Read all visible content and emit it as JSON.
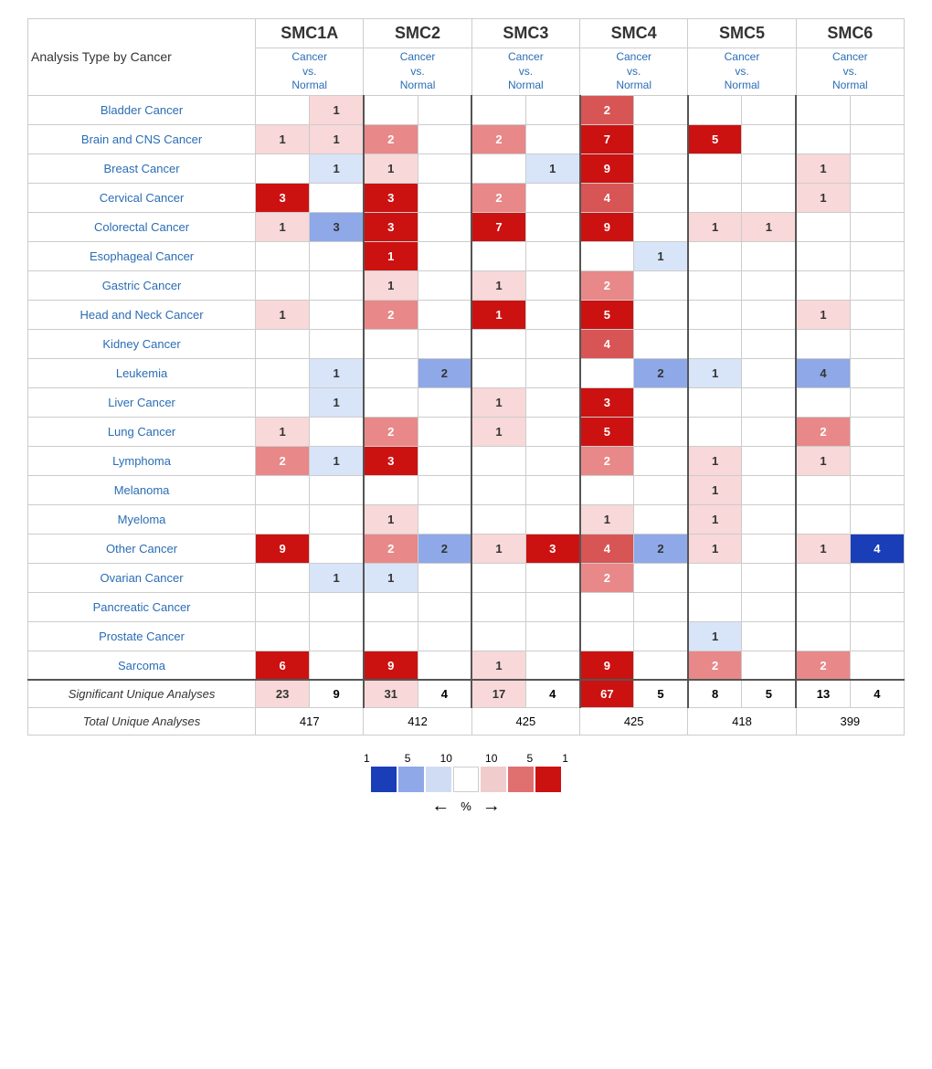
{
  "title": "Analysis Type by Cancer",
  "columns": [
    "SMC1A",
    "SMC2",
    "SMC3",
    "SMC4",
    "SMC5",
    "SMC6"
  ],
  "subHeader": "Cancer\nvs.\nNormal",
  "cancers": [
    "Bladder Cancer",
    "Brain and CNS Cancer",
    "Breast Cancer",
    "Cervical Cancer",
    "Colorectal Cancer",
    "Esophageal Cancer",
    "Gastric Cancer",
    "Head and Neck Cancer",
    "Kidney Cancer",
    "Leukemia",
    "Liver Cancer",
    "Lung Cancer",
    "Lymphoma",
    "Melanoma",
    "Myeloma",
    "Other Cancer",
    "Ovarian Cancer",
    "Pancreatic Cancer",
    "Prostate Cancer",
    "Sarcoma"
  ],
  "cells": {
    "Bladder Cancer": [
      [
        "",
        ""
      ],
      [
        "1",
        "c-r1"
      ],
      [
        "",
        ""
      ],
      [
        "2",
        "c-r4"
      ],
      [
        "",
        ""
      ],
      [
        "",
        ""
      ]
    ],
    "Brain and CNS Cancer": [
      [
        "1",
        "c-r1"
      ],
      [
        "1",
        "c-r1"
      ],
      [
        "2",
        "c-r3"
      ],
      [
        "2",
        "c-r3"
      ],
      [
        "7",
        "c-r5"
      ],
      [
        ""
      ],
      [
        "5",
        "c-r5"
      ],
      [
        ""
      ],
      [
        "",
        ""
      ],
      [
        "",
        ""
      ]
    ],
    "Breast Cancer": [
      [
        "",
        ""
      ],
      [
        "1",
        "c-b1"
      ],
      [
        "1",
        "c-r1"
      ],
      [
        "",
        ""
      ],
      [
        "1",
        "c-b1"
      ],
      [
        ""
      ],
      [
        "9",
        "c-r5"
      ],
      [
        ""
      ],
      [
        "",
        ""
      ],
      [
        "1",
        "c-r1"
      ]
    ],
    "Cervical Cancer": [
      [
        "3",
        "c-r5"
      ],
      [
        ""
      ],
      [
        "3",
        "c-r5"
      ],
      [
        ""
      ],
      [
        "2",
        "c-r3"
      ],
      [
        ""
      ],
      [
        "4",
        "c-r4"
      ],
      [
        ""
      ],
      [
        "",
        ""
      ],
      [
        "1",
        "c-r1"
      ]
    ],
    "Colorectal Cancer": [
      [
        "1",
        "c-r1"
      ],
      [
        "3",
        "c-b3"
      ],
      [
        "3",
        "c-r5"
      ],
      [
        ""
      ],
      [
        "7",
        "c-r5"
      ],
      [
        ""
      ],
      [
        "9",
        "c-r5"
      ],
      [
        ""
      ],
      [
        "1",
        "c-r1"
      ],
      [
        "1",
        "c-r1"
      ]
    ],
    "Esophageal Cancer": [
      [
        "",
        ""
      ],
      [
        "",
        ""
      ],
      [
        "1",
        "c-r5"
      ],
      [
        ""
      ],
      [
        "",
        ""
      ],
      [
        ""
      ],
      [
        "",
        ""
      ],
      [
        "1",
        "c-b1"
      ],
      [
        "",
        ""
      ],
      [
        "",
        ""
      ]
    ],
    "Gastric Cancer": [
      [
        "",
        ""
      ],
      [
        "",
        ""
      ],
      [
        "1",
        "c-r1"
      ],
      [
        ""
      ],
      [
        "1",
        "c-r1"
      ],
      [
        ""
      ],
      [
        "2",
        "c-r3"
      ],
      [
        ""
      ],
      [
        "",
        ""
      ],
      [
        "",
        ""
      ]
    ],
    "Head and Neck Cancer": [
      [
        "1",
        "c-r1"
      ],
      [
        ""
      ],
      [
        "2",
        "c-r3"
      ],
      [
        ""
      ],
      [
        "1",
        "c-r5"
      ],
      [
        ""
      ],
      [
        "5",
        "c-r5"
      ],
      [
        ""
      ],
      [
        "",
        ""
      ],
      [
        "1",
        "c-r1"
      ]
    ],
    "Kidney Cancer": [
      [
        "",
        ""
      ],
      [
        "",
        ""
      ],
      [
        "",
        ""
      ],
      [
        ""
      ],
      [
        "",
        ""
      ],
      [
        ""
      ],
      [
        "4",
        "c-r4"
      ],
      [
        ""
      ],
      [
        "",
        ""
      ],
      [
        "",
        ""
      ]
    ],
    "Leukemia": [
      [
        "",
        ""
      ],
      [
        "1",
        "c-b1"
      ],
      [
        "",
        ""
      ],
      [
        "2",
        "c-b3"
      ],
      [
        "",
        ""
      ],
      [
        ""
      ],
      [
        "",
        ""
      ],
      [
        "2",
        "c-b3"
      ],
      [
        "1",
        "c-b1"
      ],
      [
        "4",
        "c-b3"
      ]
    ],
    "Liver Cancer": [
      [
        "",
        ""
      ],
      [
        "1",
        "c-b1"
      ],
      [
        "",
        ""
      ],
      [
        ""
      ],
      [
        "1",
        "c-r1"
      ],
      [
        ""
      ],
      [
        "3",
        "c-r5"
      ],
      [
        ""
      ],
      [
        "",
        ""
      ],
      [
        "",
        ""
      ]
    ],
    "Lung Cancer": [
      [
        "1",
        "c-r1"
      ],
      [
        ""
      ],
      [
        "2",
        "c-r3"
      ],
      [
        ""
      ],
      [
        "1",
        "c-r1"
      ],
      [
        ""
      ],
      [
        "5",
        "c-r5"
      ],
      [
        ""
      ],
      [
        "",
        ""
      ],
      [
        "2",
        "c-r3"
      ]
    ],
    "Lymphoma": [
      [
        "2",
        "c-r3"
      ],
      [
        "1",
        "c-b1"
      ],
      [
        "3",
        "c-r5"
      ],
      [
        ""
      ],
      [
        "",
        ""
      ],
      [
        ""
      ],
      [
        "2",
        "c-r3"
      ],
      [
        ""
      ],
      [
        "1",
        "c-r1"
      ],
      [
        "1",
        "c-r1"
      ]
    ],
    "Melanoma": [
      [
        "",
        ""
      ],
      [
        "",
        ""
      ],
      [
        "",
        ""
      ],
      [
        ""
      ],
      [
        "",
        ""
      ],
      [
        ""
      ],
      [
        "",
        ""
      ],
      [
        ""
      ],
      [
        "1",
        "c-r1"
      ],
      [
        "",
        ""
      ]
    ],
    "Myeloma": [
      [
        "",
        ""
      ],
      [
        "",
        ""
      ],
      [
        "1",
        "c-r1"
      ],
      [
        ""
      ],
      [
        "",
        ""
      ],
      [
        ""
      ],
      [
        "1",
        "c-r1"
      ],
      [
        ""
      ],
      [
        "1",
        "c-r1"
      ],
      [
        "",
        ""
      ]
    ],
    "Other Cancer": [
      [
        "9",
        "c-r5"
      ],
      [
        ""
      ],
      [
        "2",
        "c-r3"
      ],
      [
        "2",
        "c-b3"
      ],
      [
        "1",
        "c-r1"
      ],
      [
        "3",
        "c-r5"
      ],
      [
        "4",
        "c-r4"
      ],
      [
        "2",
        "c-b3"
      ],
      [
        "1",
        "c-r1"
      ],
      [
        ""
      ],
      [
        "1",
        "c-r1"
      ],
      [
        "4",
        "c-b5"
      ]
    ],
    "Ovarian Cancer": [
      [
        "",
        ""
      ],
      [
        "1",
        "c-b1"
      ],
      [
        "1",
        "c-b1"
      ],
      [
        ""
      ],
      [
        "",
        ""
      ],
      [
        ""
      ],
      [
        "2",
        "c-r3"
      ],
      [
        ""
      ],
      [
        "",
        ""
      ],
      [
        "",
        ""
      ]
    ],
    "Pancreatic Cancer": [
      [
        "",
        ""
      ],
      [
        "",
        ""
      ],
      [
        "",
        ""
      ],
      [
        ""
      ],
      [
        "",
        ""
      ],
      [
        ""
      ],
      [
        "",
        ""
      ],
      [
        ""
      ],
      [
        "",
        ""
      ],
      [
        "",
        ""
      ]
    ],
    "Prostate Cancer": [
      [
        "",
        ""
      ],
      [
        "",
        ""
      ],
      [
        "",
        ""
      ],
      [
        ""
      ],
      [
        "",
        ""
      ],
      [
        ""
      ],
      [
        "",
        ""
      ],
      [
        ""
      ],
      [
        "1",
        "c-b1"
      ],
      [
        "",
        ""
      ]
    ],
    "Sarcoma": [
      [
        "6",
        "c-r5"
      ],
      [
        ""
      ],
      [
        "9",
        "c-r5"
      ],
      [
        ""
      ],
      [
        "1",
        "c-r1"
      ],
      [
        ""
      ],
      [
        "9",
        "c-r5"
      ],
      [
        ""
      ],
      [
        "2",
        "c-r3"
      ],
      [
        ""
      ],
      [
        "2",
        "c-r3"
      ],
      [
        "",
        "..."
      ]
    ]
  },
  "significant": {
    "label": "Significant Unique Analyses",
    "values": [
      "23",
      "9",
      "31",
      "4",
      "17",
      "4",
      "67",
      "5",
      "8",
      "5",
      "13",
      "4"
    ]
  },
  "total": {
    "label": "Total Unique Analyses",
    "values": [
      "417",
      "412",
      "425",
      "425",
      "418",
      "399"
    ]
  },
  "legend": {
    "labels_left": [
      "1",
      "5",
      "10"
    ],
    "labels_right": [
      "10",
      "5",
      "1"
    ],
    "percent": "%"
  }
}
